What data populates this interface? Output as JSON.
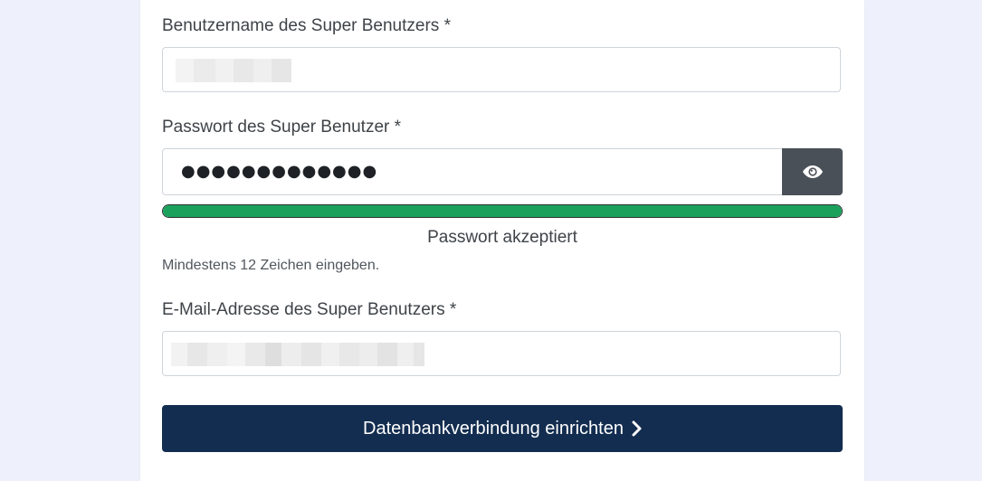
{
  "form": {
    "username": {
      "label": "Benutzername des Super Benutzers *"
    },
    "password": {
      "label": "Passwort des Super Benutzer *",
      "value": "●●●●●●●●●●●●●",
      "toggle_icon": "eye-icon",
      "strength_fraction": 1.0,
      "strength_color": "#1aa25c",
      "strength_text": "Passwort akzeptiert",
      "hint": "Mindestens 12 Zeichen eingeben."
    },
    "email": {
      "label": "E-Mail-Adresse des Super Benutzers *"
    },
    "submit": {
      "label": "Datenbankverbindung einrichten",
      "icon": "chevron-right-icon"
    }
  },
  "colors": {
    "background": "#eef1fb",
    "primary": "#132d50",
    "toggle": "#4a5057"
  }
}
